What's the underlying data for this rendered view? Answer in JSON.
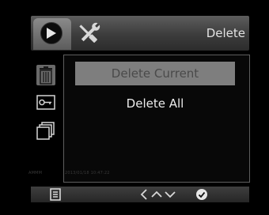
{
  "header": {
    "title": "Delete",
    "tabs": [
      {
        "icon": "play-icon",
        "active": true
      },
      {
        "icon": "wrench-screwdriver-icon",
        "active": false
      }
    ]
  },
  "sidebar": {
    "items": [
      {
        "icon": "trash-icon",
        "active": true
      },
      {
        "icon": "key-icon",
        "active": false
      },
      {
        "icon": "copy-icon",
        "active": false
      }
    ]
  },
  "menu": {
    "items": [
      {
        "label": "Delete Current",
        "highlighted": true
      },
      {
        "label": "Delete All",
        "highlighted": false
      }
    ]
  },
  "watermark": {
    "left": "AMMM",
    "right": "2013/01/18 10:47:22"
  },
  "footer": {
    "icons": [
      "menu-icon",
      "left-arrow-icon",
      "up-icon",
      "down-icon",
      "confirm-icon"
    ]
  }
}
